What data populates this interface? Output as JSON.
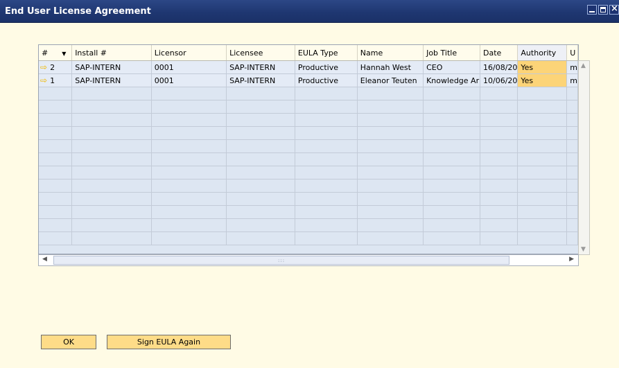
{
  "window": {
    "title": "End User License Agreement"
  },
  "columns": [
    "#",
    "Install #",
    "Licensor",
    "Licensee",
    "EULA Type",
    "Name",
    "Job Title",
    "Date",
    "Authority",
    "U"
  ],
  "rows": [
    {
      "num": "2",
      "install": "SAP-INTERN",
      "licensor": "0001",
      "licensee": "SAP-INTERN",
      "eula_type": "Productive",
      "name": "Hannah West",
      "job_title": "CEO",
      "date": "16/08/20",
      "authority": "Yes",
      "extra": "m"
    },
    {
      "num": "1",
      "install": "SAP-INTERN",
      "licensor": "0001",
      "licensee": "SAP-INTERN",
      "eula_type": "Productive",
      "name": "Eleanor Teuten",
      "job_title": "Knowledge Ar",
      "date": "10/06/20",
      "authority": "Yes",
      "extra": "m"
    }
  ],
  "buttons": {
    "ok": "OK",
    "sign": "Sign EULA Again"
  },
  "icons": {
    "row_arrow": "arrow-right-icon",
    "sort": "sort-desc-icon"
  },
  "colors": {
    "titlebar": "#1e3670",
    "background": "#fffbe5",
    "selected_cell": "#fcd478",
    "button": "#fedc88"
  }
}
